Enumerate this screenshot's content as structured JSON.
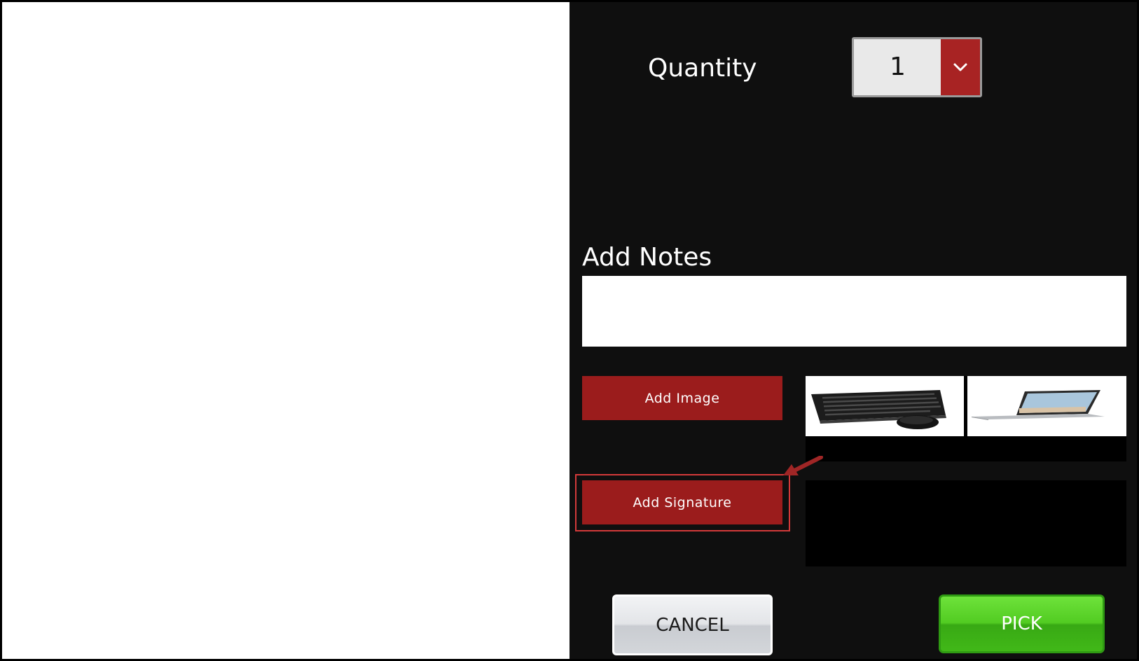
{
  "quantity": {
    "label": "Quantity",
    "value": "1",
    "dropdown_icon": "chevron-down-icon",
    "accent_color": "#a82323"
  },
  "notes": {
    "label": "Add Notes",
    "value": "",
    "placeholder": ""
  },
  "buttons": {
    "add_image": "Add Image",
    "add_signature": "Add Signature",
    "cancel": "CANCEL",
    "pick": "PICK"
  },
  "attachments": [
    {
      "name": "keyboard-and-mouse-image"
    },
    {
      "name": "laptop-image"
    }
  ],
  "colors": {
    "panel_background": "#0f0f0f",
    "action_red": "#9b1c1c",
    "highlight": "#d33a3a",
    "pick_green": "#52cc22"
  }
}
